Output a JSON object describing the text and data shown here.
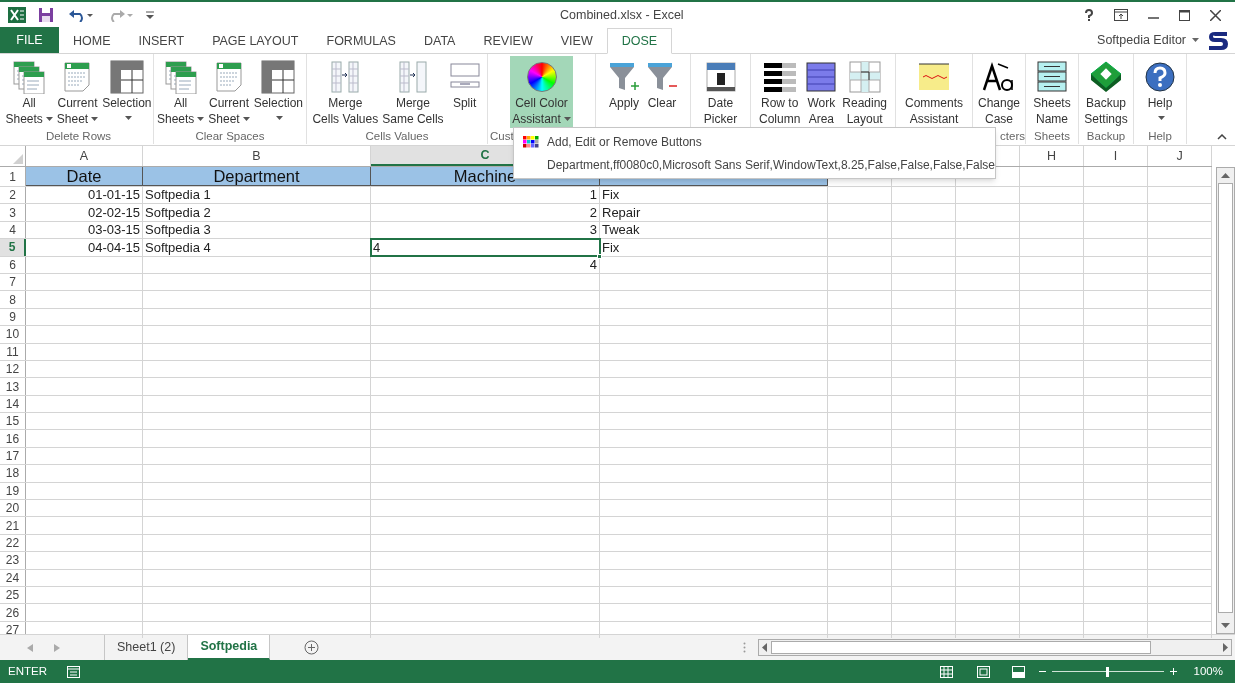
{
  "window": {
    "title": "Combined.xlsx - Excel"
  },
  "ribbon_tabs": [
    {
      "label": "FILE",
      "kind": "file",
      "selected": false
    },
    {
      "label": "HOME",
      "kind": "tab",
      "selected": false
    },
    {
      "label": "INSERT",
      "kind": "tab",
      "selected": false
    },
    {
      "label": "PAGE LAYOUT",
      "kind": "tab",
      "selected": false
    },
    {
      "label": "FORMULAS",
      "kind": "tab",
      "selected": false
    },
    {
      "label": "DATA",
      "kind": "tab",
      "selected": false
    },
    {
      "label": "REVIEW",
      "kind": "tab",
      "selected": false
    },
    {
      "label": "VIEW",
      "kind": "tab",
      "selected": false
    },
    {
      "label": "DOSE",
      "kind": "tab",
      "selected": true
    }
  ],
  "account": {
    "name": "Softpedia Editor"
  },
  "ribbon_groups": [
    {
      "label": "Delete Rows",
      "kind": "whole",
      "buttons": [
        {
          "lines": [
            "All",
            "Sheets"
          ],
          "kind": "sheets",
          "dropdown": true,
          "pressed": false
        },
        {
          "lines": [
            "Current",
            "Sheet"
          ],
          "kind": "sheet",
          "dropdown": true,
          "pressed": false
        },
        {
          "lines": [
            "Selection"
          ],
          "kind": "grid",
          "dropdown": true,
          "pressed": false
        }
      ]
    },
    {
      "label": "Clear Spaces",
      "kind": "whole",
      "buttons": [
        {
          "lines": [
            "All",
            "Sheets"
          ],
          "kind": "sheets",
          "dropdown": true,
          "pressed": false
        },
        {
          "lines": [
            "Current",
            "Sheet"
          ],
          "kind": "sheet",
          "dropdown": true,
          "pressed": false
        },
        {
          "lines": [
            "Selection"
          ],
          "kind": "grid",
          "dropdown": true,
          "pressed": false
        }
      ]
    },
    {
      "label": "Cells Values",
      "kind": "whole",
      "buttons": [
        {
          "lines": [
            "Merge",
            "Cells Values"
          ],
          "kind": "merge",
          "dropdown": false,
          "pressed": false
        },
        {
          "lines": [
            "Merge",
            "Same Cells"
          ],
          "kind": "merge2",
          "dropdown": false,
          "pressed": false
        },
        {
          "lines": [
            "Split"
          ],
          "kind": "split",
          "dropdown": false,
          "pressed": false
        }
      ]
    },
    {
      "label": "Cust",
      "kind": "head",
      "buttons": [
        {
          "lines": [
            "Cell Color",
            "Assistant"
          ],
          "kind": "wheel",
          "dropdown": true,
          "pressed": true
        }
      ]
    },
    {
      "buttons": [
        {
          "lines": [
            "Apply"
          ],
          "kind": "filteradd",
          "dropdown": false,
          "pressed": false
        },
        {
          "lines": [
            "Clear"
          ],
          "kind": "filterremove",
          "dropdown": false,
          "pressed": false
        }
      ]
    },
    {
      "buttons": [
        {
          "lines": [
            "Date",
            "Picker"
          ],
          "kind": "calendar",
          "dropdown": false,
          "pressed": false
        }
      ]
    },
    {
      "buttons": [
        {
          "lines": [
            "Row to",
            "Column"
          ],
          "kind": "stripes",
          "dropdown": false,
          "pressed": false
        },
        {
          "lines": [
            "Work",
            "Area"
          ],
          "kind": "table",
          "dropdown": false,
          "pressed": false
        },
        {
          "lines": [
            "Reading",
            "Layout"
          ],
          "kind": "reading",
          "dropdown": false,
          "pressed": false
        }
      ]
    },
    {
      "buttons": [
        {
          "lines": [
            "Comments",
            "Assistant"
          ],
          "kind": "note",
          "dropdown": false,
          "pressed": false
        }
      ]
    },
    {
      "label": "cters",
      "kind": "tail",
      "buttons": [
        {
          "lines": [
            "Change",
            "Case"
          ],
          "kind": "case",
          "dropdown": false,
          "pressed": false
        }
      ]
    },
    {
      "label": "Sheets",
      "kind": "whole",
      "buttons": [
        {
          "lines": [
            "Sheets",
            "Name"
          ],
          "kind": "sheetlist",
          "dropdown": false,
          "pressed": false
        }
      ]
    },
    {
      "label": "Backup",
      "kind": "whole",
      "buttons": [
        {
          "lines": [
            "Backup",
            "Settings"
          ],
          "kind": "backup",
          "dropdown": false,
          "pressed": false
        }
      ]
    },
    {
      "label": "Help",
      "kind": "whole",
      "buttons": [
        {
          "lines": [
            "Help"
          ],
          "kind": "help",
          "dropdown": true,
          "pressed": false
        }
      ]
    }
  ],
  "dropdown_menu": [
    {
      "label": "Add, Edit or Remove Buttons",
      "kind": "icon"
    },
    {
      "label": "Department,ff0080c0,Microsoft Sans Serif,WindowText,8.25,False,False,False,False",
      "kind": "plain"
    }
  ],
  "columns": [
    {
      "label": "A",
      "selected": false
    },
    {
      "label": "B",
      "selected": false
    },
    {
      "label": "C",
      "selected": true
    },
    {},
    {},
    {},
    {},
    {
      "label": "H",
      "selected": false
    },
    {
      "label": "I",
      "selected": false
    },
    {
      "label": "J",
      "selected": false
    }
  ],
  "rows": [
    {
      "number": "1",
      "selected": false,
      "cells": [
        {
          "text": "Date",
          "kind": "header"
        },
        {
          "text": "Department",
          "kind": "header"
        },
        {
          "text": "Machine",
          "kind": "header"
        },
        {
          "kind": "header"
        }
      ]
    },
    {
      "number": "2",
      "selected": false,
      "cells": [
        {
          "text": "01-01-15",
          "kind": "number"
        },
        {
          "text": "Softpedia 1",
          "kind": "text"
        },
        {
          "text": "1",
          "kind": "number"
        },
        {
          "text": "Fix",
          "kind": "text"
        }
      ]
    },
    {
      "number": "3",
      "selected": false,
      "cells": [
        {
          "text": "02-02-15",
          "kind": "number"
        },
        {
          "text": "Softpedia 2",
          "kind": "text"
        },
        {
          "text": "2",
          "kind": "number"
        },
        {
          "text": "Repair",
          "kind": "text"
        }
      ]
    },
    {
      "number": "4",
      "selected": false,
      "cells": [
        {
          "text": "03-03-15",
          "kind": "number"
        },
        {
          "text": "Softpedia 3",
          "kind": "text"
        },
        {
          "text": "3",
          "kind": "number"
        },
        {
          "text": "Tweak",
          "kind": "text"
        }
      ]
    },
    {
      "number": "5",
      "selected": true,
      "cells": [
        {
          "text": "04-04-15",
          "kind": "number"
        },
        {
          "text": "Softpedia 4",
          "kind": "text"
        },
        {
          "text": "4",
          "kind": "text"
        },
        {
          "text": "Fix",
          "kind": "text"
        }
      ]
    },
    {
      "number": "6",
      "selected": false,
      "cells": [
        {},
        {},
        {
          "text": "4",
          "kind": "number"
        }
      ]
    },
    {
      "number": "7",
      "selected": false
    },
    {
      "number": "8",
      "selected": false
    },
    {
      "number": "9",
      "selected": false
    },
    {
      "number": "10",
      "selected": false
    },
    {
      "number": "11",
      "selected": false
    },
    {
      "number": "12",
      "selected": false
    },
    {
      "number": "13",
      "selected": false
    },
    {
      "number": "14",
      "selected": false
    },
    {
      "number": "15",
      "selected": false
    },
    {
      "number": "16",
      "selected": false
    },
    {
      "number": "17",
      "selected": false
    },
    {
      "number": "18",
      "selected": false
    },
    {
      "number": "19",
      "selected": false
    },
    {
      "number": "20",
      "selected": false
    },
    {
      "number": "21",
      "selected": false
    },
    {
      "number": "22",
      "selected": false
    },
    {
      "number": "23",
      "selected": false
    },
    {
      "number": "24",
      "selected": false
    },
    {
      "number": "25",
      "selected": false
    },
    {
      "number": "26",
      "selected": false
    },
    {
      "number": "27",
      "selected": false
    }
  ],
  "sheet_tabs": [
    {
      "label": "Sheet1 (2)",
      "selected": false
    },
    {
      "label": "Softpedia",
      "selected": true
    }
  ],
  "status_bar": {
    "mode": "ENTER",
    "zoom": {
      "label": "100%",
      "level": 0.5
    }
  }
}
